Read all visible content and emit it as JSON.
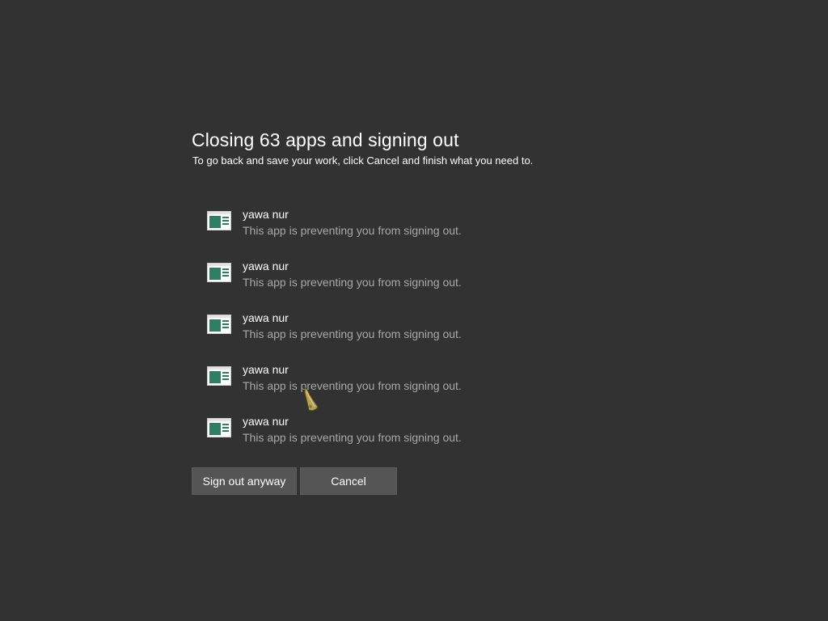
{
  "dialog": {
    "title": "Closing 63 apps and signing out",
    "subtitle": "To go back and save your work, click Cancel and finish what you need to."
  },
  "apps": [
    {
      "name": "yawa nur",
      "status": "This app is preventing you from signing out.",
      "icon": "app-window-icon"
    },
    {
      "name": "yawa nur",
      "status": "This app is preventing you from signing out.",
      "icon": "app-window-icon"
    },
    {
      "name": "yawa nur",
      "status": "This app is preventing you from signing out.",
      "icon": "app-window-icon"
    },
    {
      "name": "yawa nur",
      "status": "This app is preventing you from signing out.",
      "icon": "app-window-icon"
    },
    {
      "name": "yawa nur",
      "status": "This app is preventing you from signing out.",
      "icon": "app-window-icon"
    }
  ],
  "buttons": {
    "sign_out_label": "Sign out anyway",
    "cancel_label": "Cancel"
  },
  "colors": {
    "background": "#323232",
    "button": "#555555",
    "secondary_text": "#a8a8a8"
  }
}
